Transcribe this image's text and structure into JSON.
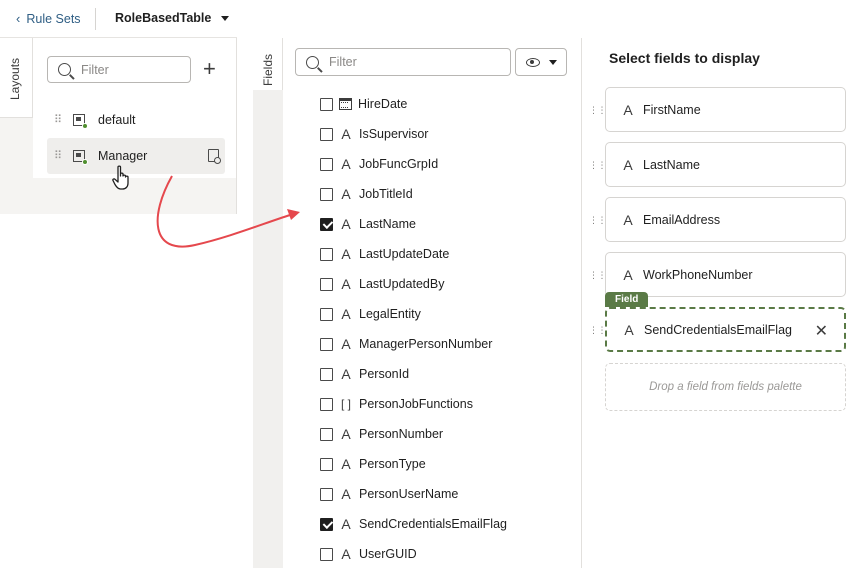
{
  "topbar": {
    "back_label": "Rule Sets",
    "ruleset_name": "RoleBasedTable"
  },
  "layouts": {
    "tab_label": "Layouts",
    "search_placeholder": "Filter",
    "add_icon": "plus-icon",
    "items": [
      {
        "label": "default",
        "selected": false
      },
      {
        "label": "Manager",
        "selected": true
      }
    ]
  },
  "fields": {
    "tab_label": "Fields",
    "search_placeholder": "Filter",
    "view_icon": "eye-icon",
    "items": [
      {
        "label": "HireDate",
        "type": "date",
        "checked": false
      },
      {
        "label": "IsSupervisor",
        "type": "text",
        "checked": false
      },
      {
        "label": "JobFuncGrpId",
        "type": "text",
        "checked": false
      },
      {
        "label": "JobTitleId",
        "type": "text",
        "checked": false
      },
      {
        "label": "LastName",
        "type": "text",
        "checked": true
      },
      {
        "label": "LastUpdateDate",
        "type": "text",
        "checked": false
      },
      {
        "label": "LastUpdatedBy",
        "type": "text",
        "checked": false
      },
      {
        "label": "LegalEntity",
        "type": "text",
        "checked": false
      },
      {
        "label": "ManagerPersonNumber",
        "type": "text",
        "checked": false
      },
      {
        "label": "PersonId",
        "type": "text",
        "checked": false
      },
      {
        "label": "PersonJobFunctions",
        "type": "array",
        "checked": false
      },
      {
        "label": "PersonNumber",
        "type": "text",
        "checked": false
      },
      {
        "label": "PersonType",
        "type": "text",
        "checked": false
      },
      {
        "label": "PersonUserName",
        "type": "text",
        "checked": false
      },
      {
        "label": "SendCredentialsEmailFlag",
        "type": "text",
        "checked": true
      },
      {
        "label": "UserGUID",
        "type": "text",
        "checked": false
      }
    ]
  },
  "selected": {
    "title": "Select fields to display",
    "items": [
      {
        "label": "FirstName",
        "dragging": false
      },
      {
        "label": "LastName",
        "dragging": false
      },
      {
        "label": "EmailAddress",
        "dragging": false
      },
      {
        "label": "WorkPhoneNumber",
        "dragging": false
      },
      {
        "label": "SendCredentialsEmailFlag",
        "dragging": true
      }
    ],
    "drag_badge": "Field",
    "drop_hint": "Drop a field from fields palette"
  },
  "colors": {
    "accent_green": "#5a7a46",
    "link_blue": "#2f5e84",
    "arrow_red": "#e5484d"
  }
}
